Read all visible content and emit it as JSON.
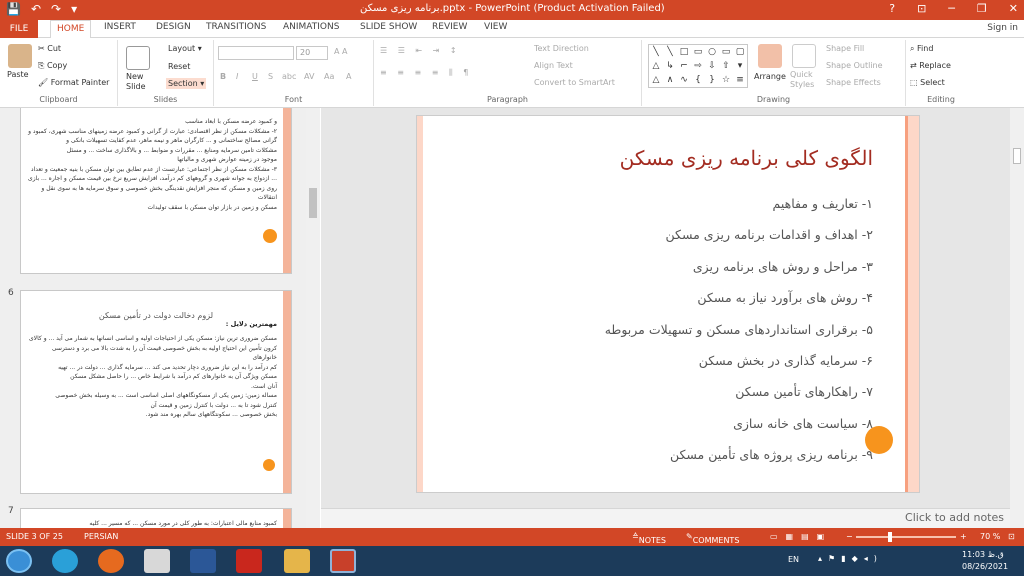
{
  "window": {
    "title": "برنامه ریزی مسکن.pptx - PowerPoint (Product Activation Failed)",
    "help": "?",
    "minimize": "─",
    "restore": "❐",
    "close": "✕",
    "ribbon_display": "⊡"
  },
  "qat": {
    "save": "💾",
    "undo": "↶",
    "redo": "↷",
    "customize": "▾"
  },
  "tabs": [
    "FILE",
    "HOME",
    "INSERT",
    "DESIGN",
    "TRANSITIONS",
    "ANIMATIONS",
    "SLIDE SHOW",
    "REVIEW",
    "VIEW"
  ],
  "signin": "Sign in",
  "ribbon": {
    "clipboard": {
      "label": "Clipboard",
      "paste": "Paste",
      "cut": "Cut",
      "copy": "Copy",
      "format_painter": "Format Painter"
    },
    "slides": {
      "label": "Slides",
      "new_slide": "New Slide",
      "layout": "Layout",
      "reset": "Reset",
      "section": "Section"
    },
    "font": {
      "label": "Font",
      "size": "20",
      "bold": "B",
      "italic": "I",
      "underline": "U",
      "strike": "S",
      "shadow": "abc",
      "spacing": "AV",
      "case": "Aa",
      "color": "A"
    },
    "paragraph": {
      "label": "Paragraph",
      "text_direction": "Text Direction",
      "align_text": "Align Text",
      "smartart": "Convert to SmartArt"
    },
    "drawing": {
      "label": "Drawing",
      "arrange": "Arrange",
      "quick_styles": "Quick Styles",
      "shape_fill": "Shape Fill",
      "shape_outline": "Shape Outline",
      "shape_effects": "Shape Effects",
      "shapes": [
        "╲",
        "╲",
        "□",
        "▭",
        "○",
        "▭",
        "▢",
        "△",
        "↳",
        "⌐",
        "⇨",
        "⇩",
        "⇧",
        "▾",
        "△",
        "∧",
        "∿",
        "{",
        "}",
        "☆",
        "≡"
      ]
    },
    "editing": {
      "label": "Editing",
      "find": "Find",
      "replace": "Replace",
      "select": "Select"
    }
  },
  "thumbnails": [
    {
      "number": "",
      "lines": [
        "و کمبود عرضه مسکن با ابعاد مناسب",
        "۲- مشکلات مسکن از نظر اقتصادی: عبارت از گرانی و کمبود عرضه زمینهای مناسب شهری، کمبود و گرانی مصالح ساختمانی و ... کارگران ماهر و نیمه ماهر، عدم کفایت تسهیلات بانکی و",
        "مشکلات تامین سرمایه ومنابع ... مقررات و ضوابط ... و بالاگذاری ساخت ... و مسئل",
        "موجود در زمینه عوارض شهری و مالیاتها",
        "۳- مشکلات مسکن از نظر اجتماعی: عبارتست از عدم تطابق بین توان مسکن با بنیه جمعیت و تعداد ... ازدواج به جوانه شهری و گروههای کم درآمد، افزایش سریع نرخ بین قیمت مسکن و اجاره ... بازی",
        "روی زمین و مسکن که منجر افزایش نقدینگی بخش خصوصی و سوق سرمایه ها به سوی نقل و انتقالات",
        "مسکن و زمین در بازار توان مسکن با سقف تولیدات"
      ]
    },
    {
      "number": "6",
      "heading": "لزوم دخالت دولت در تأمین مسکن",
      "subheading": "مهمترین دلایل :",
      "lines": [
        "مسکن ضروری ترین نیاز: مسکن یکی از احتیاجات اولیه و اساسی انسانها به شمار می آید ... و کالای",
        "کرون تأمین این احتیاج اولیه به بخش خصوصی قیمت آن را به شدت بالا می برد و دسترسی خانوارهای",
        "کم درآمد را به این نیاز ضروری دچار تحدید می کند ... سرمایه گذاری ... دولت در ... تهیه",
        "مسکن ویژگی آن به خانوارهای کم درآمد با شرایط خاص ... را حاصل مشکل مسکن",
        "آنان است.",
        "مساله زمین: زمین یکی از مسکونگاههای اصلی اساسی است ... به وسیله بخش خصوصی",
        "کنترل شود تا به ... دولت با کنترل زمین و قیمت آن",
        "بخش خصوصی ... سکونتگاههای سالم بهره مند شود."
      ]
    },
    {
      "number": "7",
      "lines": [
        "کمبود منابع مالی اعتبارات: به طور کلی در مورد مسکن ... که مسیر ... کلیه"
      ]
    }
  ],
  "thumb_header_5": "",
  "slide": {
    "title": "الگوی کلی برنامه ریزی مسکن",
    "items": [
      "۱- تعاریف و مفاهیم",
      "۲- اهداف و اقدامات برنامه ریزی مسکن",
      "۳- مراحل و روش های برنامه ریزی",
      "۴- روش های برآورد نیاز به مسکن",
      "۵- برقراری استانداردهای مسکن و تسهیلات مربوطه",
      "۶- سرمایه گذاری در بخش مسکن",
      "۷- راهکارهای تأمین مسکن",
      "۸- سیاست های خانه سازی",
      "۹- برنامه ریزی پروژه های تأمین مسکن"
    ],
    "accent": "#a32c21"
  },
  "notes_placeholder": "Click to add notes",
  "status": {
    "slide": "SLIDE 3 OF 25",
    "language": "PERSIAN",
    "notes": "NOTES",
    "comments": "COMMENTS",
    "zoom": "70 %",
    "zoom_level": 70
  },
  "taskbar": {
    "lang": "EN",
    "time": "11:03 ق.ظ",
    "date": "08/26/2021"
  },
  "colors": {
    "accent": "#d24726",
    "bullet_dot": "#f7941d",
    "band": "#fdd7c8"
  }
}
